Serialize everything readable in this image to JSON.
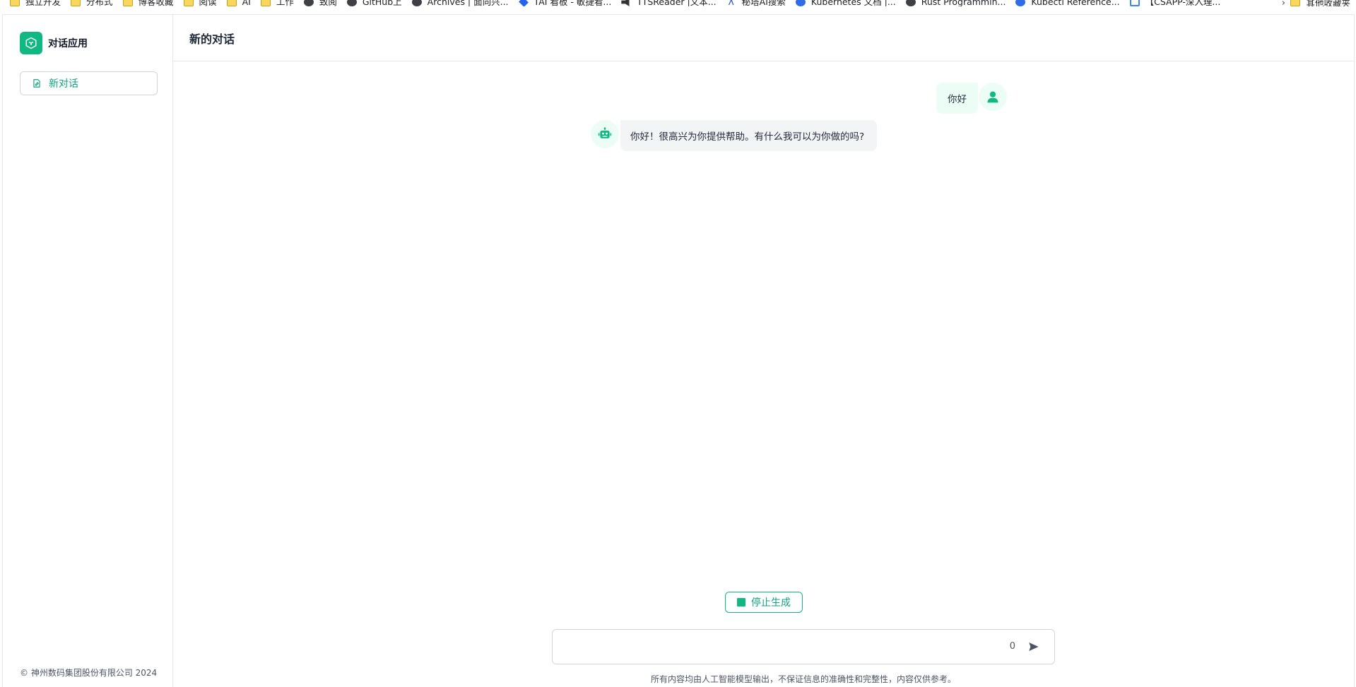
{
  "bookmarks": {
    "items": [
      {
        "label": "独立开发",
        "icon": "folder-icon"
      },
      {
        "label": "分布式",
        "icon": "folder-icon"
      },
      {
        "label": "博客收藏",
        "icon": "folder-icon"
      },
      {
        "label": "阅读",
        "icon": "folder-icon"
      },
      {
        "label": "AI",
        "icon": "folder-icon"
      },
      {
        "label": "工作",
        "icon": "folder-icon"
      },
      {
        "label": "致阅",
        "icon": "site-icon"
      },
      {
        "label": "GitHub上",
        "icon": "github-icon"
      },
      {
        "label": "Archives | 面向兴...",
        "icon": "site-icon"
      },
      {
        "label": "TAI 看板 - 敏捷看...",
        "icon": "diamond-icon"
      },
      {
        "label": "TTSReader |文本...",
        "icon": "speaker-icon"
      },
      {
        "label": "秘塔AI搜索",
        "icon": "lambda-icon"
      },
      {
        "label": "Kubernetes 文档 |...",
        "icon": "kubernetes-icon"
      },
      {
        "label": "Rust Programmin...",
        "icon": "rust-icon"
      },
      {
        "label": "Kubectl Reference...",
        "icon": "kubernetes-icon"
      },
      {
        "label": "【CSAPP-深入理...",
        "icon": "bilibili-icon"
      }
    ],
    "other": "其他收藏夹"
  },
  "sidebar": {
    "app_title": "对话应用",
    "new_chat_label": "新对话",
    "copyright": "© 神州数码集团股份有限公司 2024"
  },
  "header": {
    "title": "新的对话"
  },
  "messages": [
    {
      "role": "user",
      "text": "你好"
    },
    {
      "role": "assistant",
      "text": "你好！很高兴为你提供帮助。有什么我可以为你做的吗?"
    }
  ],
  "controls": {
    "stop_label": "停止生成",
    "input_value": "",
    "char_count": "0",
    "disclaimer": "所有内容均由人工智能模型输出，不保证信息的准确性和完整性，内容仅供参考。"
  },
  "colors": {
    "accent": "#10b981",
    "accent_text": "#10a37f",
    "user_bubble": "#ecfdf5",
    "bot_bubble": "#f3f4f6"
  }
}
